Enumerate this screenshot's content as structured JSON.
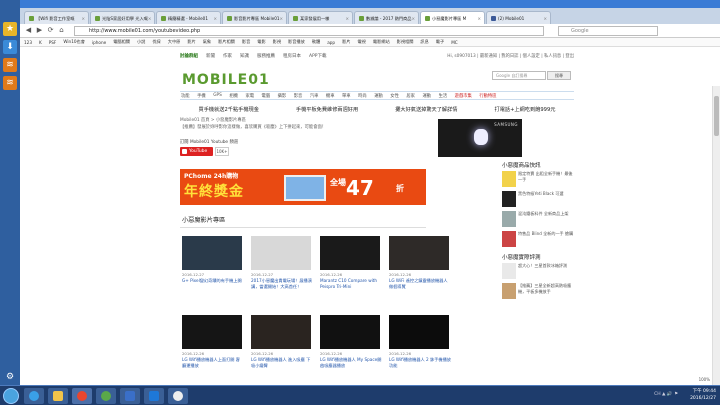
{
  "browser": {
    "tabs": [
      {
        "label": "【Wifi 影音工作室嘅",
        "active": false
      },
      {
        "label": "光陰S家居好用學 光入嘅",
        "active": false
      },
      {
        "label": "精簡精選 - Mobile01",
        "active": false
      },
      {
        "label": "影音影片專區 Mobile01",
        "active": false
      },
      {
        "label": "某家發展用一樣",
        "active": false
      },
      {
        "label": "數據論 - 2017 熱門商品",
        "active": false
      },
      {
        "label": "小惡魔影片專區 M",
        "active": true
      },
      {
        "label": "(2) Mobile01",
        "active": false
      }
    ],
    "nav": {
      "back": "◀",
      "forward": "▶",
      "reload": "⟳",
      "home": "⌂"
    },
    "url": "http://www.mobile01.com/youtubevideo.php",
    "search_placeholder": "Google",
    "bookmarks": [
      "123",
      "K",
      "PSF",
      "Win10也會",
      "iphone",
      "電腦相關",
      "小說",
      "伐採",
      "大中原",
      "影片",
      "氣象",
      "影片相關",
      "影音",
      "電影",
      "影視",
      "影音播放",
      "軟體",
      "app",
      "影片",
      "電視",
      "電影網站",
      "影視相關",
      "訊息",
      "電子",
      "MC"
    ]
  },
  "site": {
    "topnav": [
      {
        "label": "討論群組",
        "selected": true
      },
      {
        "label": "新聞",
        "selected": false
      },
      {
        "label": "作家",
        "selected": false
      },
      {
        "label": "知識",
        "selected": false
      },
      {
        "label": "服務推薦",
        "selected": false
      },
      {
        "label": "租房日本",
        "selected": false
      },
      {
        "label": "APP下載",
        "selected": false
      }
    ],
    "toplinks": "Hi, s0907013 | 最新通知 | 我的日誌 | 個人設定 | 私人訊息 | 登出",
    "logo": "MOBILE01",
    "gsearch_placeholder": "Google 自訂搜尋",
    "gsearch_btn": "搜尋",
    "categories": [
      "功能",
      "手機",
      "GPS",
      "相機",
      "家電",
      "電腦",
      "攝影",
      "影音",
      "汽車",
      "機車",
      "單車",
      "時尚",
      "運動",
      "女性",
      "居家",
      "運動",
      "生活",
      "遊戲市集",
      "行動特區"
    ],
    "promos": [
      "買手機就送2千點手機現金",
      "手機平板免費維修兩週好用",
      "攤大好氣送掉驚天了解詳情",
      "打電話+上網吃到飽999元"
    ],
    "notice": "Mobile01 首頁 > 小惡魔影片專區",
    "notice2": "【推薦】發展於妳呼影你這樣做，喜欣購買《吸塵》上下拼起來，可能會面！",
    "subscribe": "訂閱 Mobile01 Youtube 頻道",
    "yt_label": "YouTube",
    "yt_count": "10K+",
    "samsung": "SAMSUNG",
    "banner": {
      "pchome": "PChome 24h購物",
      "headline": "年終獎金",
      "prefix": "全場",
      "number": "47",
      "suffix": "折"
    },
    "section_title": "小惡魔影片專區",
    "videos": [
      {
        "date": "2016-12-27",
        "title": "G+ Pixel變幻奇蹟的有手機上開"
      },
      {
        "date": "2016-12-27",
        "title": "2017小惡魔出貴電玩場！展播演講，當選開始！大高首任！"
      },
      {
        "date": "2016-12-26",
        "title": "Marantz C10 Compare with Peispro Tri-Mini"
      },
      {
        "date": "2016-12-26",
        "title": "LG WiFi 遙控之鎮靈播放機器人做個導覽"
      },
      {
        "date": "2016-12-26",
        "title": "LG Wifi播放機器人上面打開 客廳運播放"
      },
      {
        "date": "2016-12-26",
        "title": "LG Wifi播放機器人 進入吸塵 下吸小鐵臂"
      },
      {
        "date": "2016-12-26",
        "title": "LG Wifi播放機器人 My Space開啟吸塵器播放"
      },
      {
        "date": "2016-12-26",
        "title": "LG Wifi播放機器人 2 牀手機播放功能"
      }
    ],
    "right_sections": [
      {
        "heading": "小惡魔商品快訊",
        "items": [
          {
            "text": "限定特賣 出租全新手機！最後一手"
          },
          {
            "text": "黑色特級Yeti Black 可選"
          },
          {
            "text": "混沌鐵板料件 全新商品上架"
          },
          {
            "text": "特售品 Blind 全新的一手 搶購"
          }
        ]
      },
      {
        "heading": "小惡魔實際評測",
        "items": [
          {
            "text": "超大心！三星首款冰箱評測"
          },
          {
            "text": "【推薦】三星全新超高熱吸塵機，平板多機放手"
          }
        ]
      }
    ],
    "zoom": "100%"
  },
  "taskbar": {
    "time": "下午 09:44",
    "date": "2016/12/27",
    "tray": "CH ▲ 🔊 ⚑"
  },
  "colors": {
    "accent": "#5a9a2f",
    "banner": "#e94a12",
    "youtube": "#dd2222"
  }
}
